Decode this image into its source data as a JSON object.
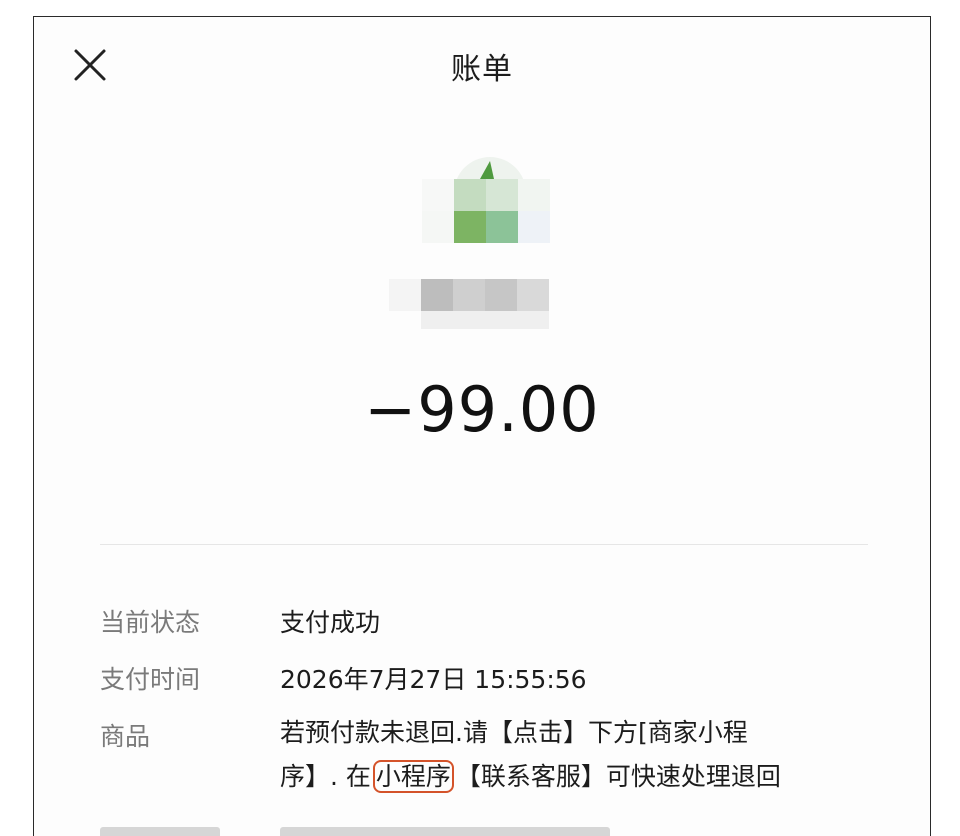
{
  "header": {
    "title": "账单",
    "close_icon": "close-icon"
  },
  "merchant": {
    "avatar": "pixelated-merchant-logo",
    "name_obscured": true
  },
  "amount": "−99.00",
  "details": [
    {
      "label": "当前状态",
      "value": "支付成功"
    },
    {
      "label": "支付时间",
      "value": "2026年7月27日 15:55:56"
    }
  ],
  "goods": {
    "label": "商品",
    "line1": "若预付款未退回.请【点击】下方[商家小程",
    "line2_before": "序】. 在",
    "line2_highlight": "小程序",
    "line2_after": "【联系客服】可快速处理退回"
  },
  "colors": {
    "highlight_border": "#d4532a",
    "label_gray": "#7a7a7a",
    "avatar_green": "#7db463"
  }
}
